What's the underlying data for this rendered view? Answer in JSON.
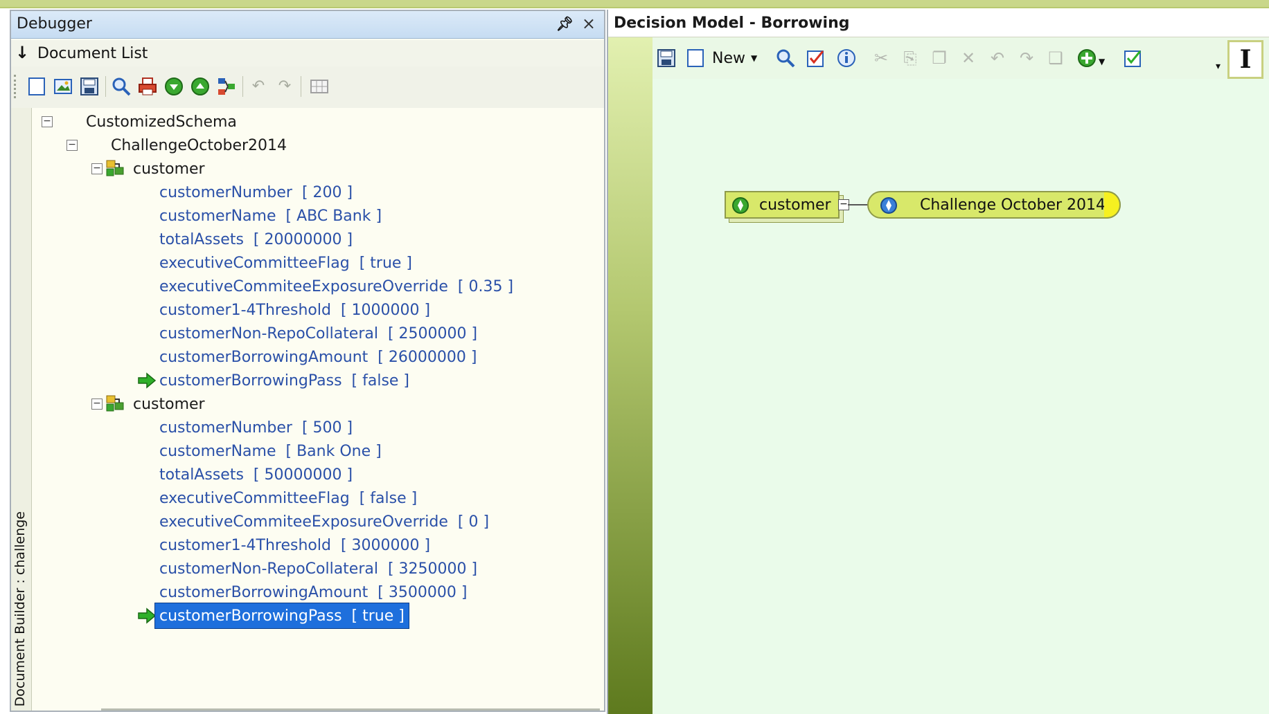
{
  "debugger": {
    "title": "Debugger",
    "pin_icon": "pin-icon",
    "close_label": "×",
    "document_list_label": "Document List",
    "side_tab_label": "Document Builder : challenge",
    "toolbar_icons": [
      "new-document-icon",
      "open-image-icon",
      "save-icon",
      "find-icon",
      "print-icon",
      "move-down-icon",
      "move-up-icon",
      "schema-icon",
      "undo-icon",
      "redo-icon",
      "grid-icon"
    ],
    "tree": {
      "root": "CustomizedSchema",
      "child": "ChallengeOctober2014",
      "customers": [
        {
          "label": "customer",
          "fields": [
            {
              "name": "customerNumber",
              "value": "[ 200 ]"
            },
            {
              "name": "customerName",
              "value": "[ ABC Bank ]"
            },
            {
              "name": "totalAssets",
              "value": "[ 20000000 ]"
            },
            {
              "name": "executiveCommitteeFlag",
              "value": "[ true ]"
            },
            {
              "name": "executiveCommiteeExposureOverride",
              "value": "[ 0.35 ]"
            },
            {
              "name": "customer1-4Threshold",
              "value": "[ 1000000 ]"
            },
            {
              "name": "customerNon-RepoCollateral",
              "value": "[ 2500000 ]"
            },
            {
              "name": "customerBorrowingAmount",
              "value": "[ 26000000 ]"
            },
            {
              "name": "customerBorrowingPass",
              "value": "[ false ]"
            }
          ]
        },
        {
          "label": "customer",
          "fields": [
            {
              "name": "customerNumber",
              "value": "[ 500 ]"
            },
            {
              "name": "customerName",
              "value": "[ Bank One ]"
            },
            {
              "name": "totalAssets",
              "value": "[ 50000000 ]"
            },
            {
              "name": "executiveCommitteeFlag",
              "value": "[ false ]"
            },
            {
              "name": "executiveCommiteeExposureOverride",
              "value": "[ 0 ]"
            },
            {
              "name": "customer1-4Threshold",
              "value": "[ 3000000 ]"
            },
            {
              "name": "customerNon-RepoCollateral",
              "value": "[ 3250000 ]"
            },
            {
              "name": "customerBorrowingAmount",
              "value": "[ 3500000 ]"
            },
            {
              "name": "customerBorrowingPass",
              "value": "[ true ]"
            }
          ]
        }
      ]
    }
  },
  "model": {
    "title": "Decision Model -  Borrowing",
    "new_label": "New",
    "entity_label": "customer",
    "decision_label": "Challenge October 2014"
  },
  "colors": {
    "value_text": "#2a50a8",
    "selection": "#1e6fdc",
    "canvas": "#eafbea",
    "node_fill": "#d8e86a"
  }
}
